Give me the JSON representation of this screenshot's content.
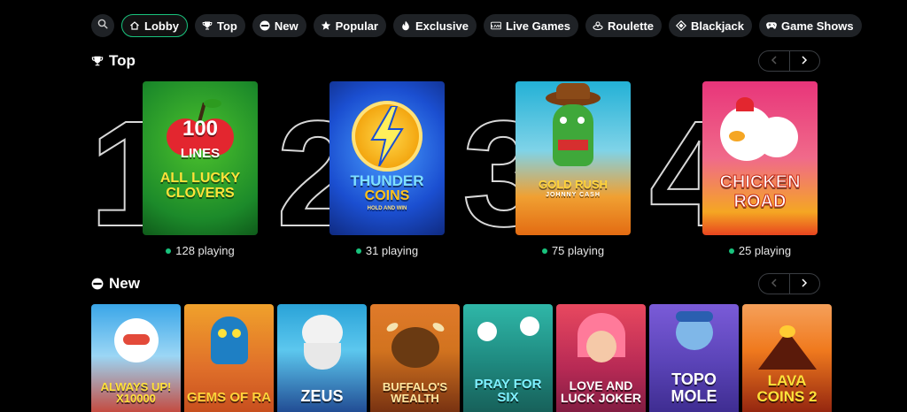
{
  "categories": [
    {
      "label": "Lobby",
      "icon": "home-icon",
      "active": true
    },
    {
      "label": "Top",
      "icon": "trophy-icon"
    },
    {
      "label": "New",
      "icon": "new-badge-icon"
    },
    {
      "label": "Popular",
      "icon": "star-icon"
    },
    {
      "label": "Exclusive",
      "icon": "flame-icon"
    },
    {
      "label": "Live Games",
      "icon": "live-icon"
    },
    {
      "label": "Roulette",
      "icon": "roulette-icon"
    },
    {
      "label": "Blackjack",
      "icon": "diamond-icon"
    },
    {
      "label": "Game Shows",
      "icon": "gamepad-icon"
    }
  ],
  "top_section": {
    "title": "Top",
    "games": [
      {
        "rank": "1",
        "title_line1": "100",
        "title_line2": "LINES",
        "title_line3": "ALL LUCKY CLOVERS",
        "playing": "128 playing",
        "bg": "#1c8a2a",
        "accent": "#e3262f"
      },
      {
        "rank": "2",
        "title_line1": "THUNDER",
        "title_line2": "COINS",
        "title_line3": "HOLD AND WIN",
        "playing": "31 playing",
        "bg": "#1b4fd1",
        "accent": "#ffc21a"
      },
      {
        "rank": "3",
        "title_line1": "GOLD RUSH",
        "title_line2": "JOHNNY CASH",
        "title_line3": "",
        "playing": "75 playing",
        "bg": "#23b1d6",
        "accent": "#e36b12"
      },
      {
        "rank": "4",
        "title_line1": "CHICKEN",
        "title_line2": "ROAD",
        "title_line3": "",
        "playing": "25 playing",
        "bg": "#e8357a",
        "accent": "#f5a623"
      }
    ]
  },
  "new_section": {
    "title": "New",
    "games": [
      {
        "title": "ALWAYS UP! X10000",
        "bg1": "#3aa6e8",
        "bg2": "#c93a2a"
      },
      {
        "title": "GEMS OF RA",
        "bg1": "#f0a12b",
        "bg2": "#c44a1c"
      },
      {
        "title": "ZEUS",
        "bg1": "#2aa3d8",
        "bg2": "#1b3f8a"
      },
      {
        "title": "BUFFALO'S WEALTH",
        "bg1": "#d2731f",
        "bg2": "#6e2b10"
      },
      {
        "title": "PRAY FOR SIX",
        "bg1": "#2fb7a8",
        "bg2": "#165b55"
      },
      {
        "title": "LOVE AND LUCK JOKER",
        "bg1": "#e8485f",
        "bg2": "#7a1a3f"
      },
      {
        "title": "TOPO MOLE",
        "bg1": "#7a5bd8",
        "bg2": "#3b2a8c"
      },
      {
        "title": "LAVA COINS 2",
        "bg1": "#f07a1e",
        "bg2": "#8a1d0e"
      }
    ]
  }
}
